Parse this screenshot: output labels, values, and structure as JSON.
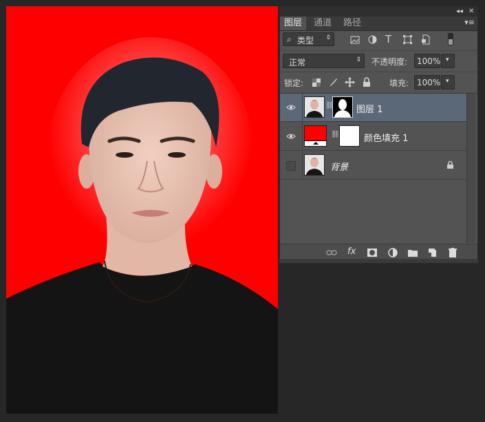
{
  "document": {
    "background_color": "#ff0000"
  },
  "panel": {
    "collapse_label": "◂◂",
    "close_label": "✕",
    "menu_label": "▾≡",
    "tabs": [
      {
        "label": "图层",
        "active": true
      },
      {
        "label": "通道",
        "active": false
      },
      {
        "label": "路径",
        "active": false
      }
    ],
    "filter": {
      "kind_label": "类型",
      "icons": [
        "image-filter-icon",
        "adjustment-filter-icon",
        "type-filter-icon",
        "shape-filter-icon",
        "smart-object-filter-icon",
        "filter-toggle-icon"
      ]
    },
    "blend": {
      "mode": "正常",
      "opacity_label": "不透明度:",
      "opacity_value": "100%"
    },
    "lock": {
      "label": "锁定:",
      "icons": [
        "lock-transparent-icon",
        "lock-paint-icon",
        "lock-move-icon",
        "lock-all-icon"
      ],
      "fill_label": "填充:",
      "fill_value": "100%"
    },
    "layers": [
      {
        "name": "图层 1",
        "visible": true,
        "selected": true,
        "has_mask": true,
        "thumb": "photo"
      },
      {
        "name": "颜色填充 1",
        "visible": true,
        "selected": false,
        "has_mask": true,
        "thumb": "fill",
        "fill_color": "#ff0000"
      },
      {
        "name": "背景",
        "visible": false,
        "selected": false,
        "has_mask": false,
        "thumb": "photo",
        "locked": true
      }
    ],
    "footer_icons": [
      "link-layers-icon",
      "fx-icon",
      "add-mask-icon",
      "adjustment-layer-icon",
      "group-folder-icon",
      "new-layer-icon",
      "trash-icon"
    ],
    "fx_label": "fx"
  },
  "colors": {
    "panel_bg": "#535353",
    "selected_layer": "#5b6878",
    "workspace": "#272727"
  }
}
